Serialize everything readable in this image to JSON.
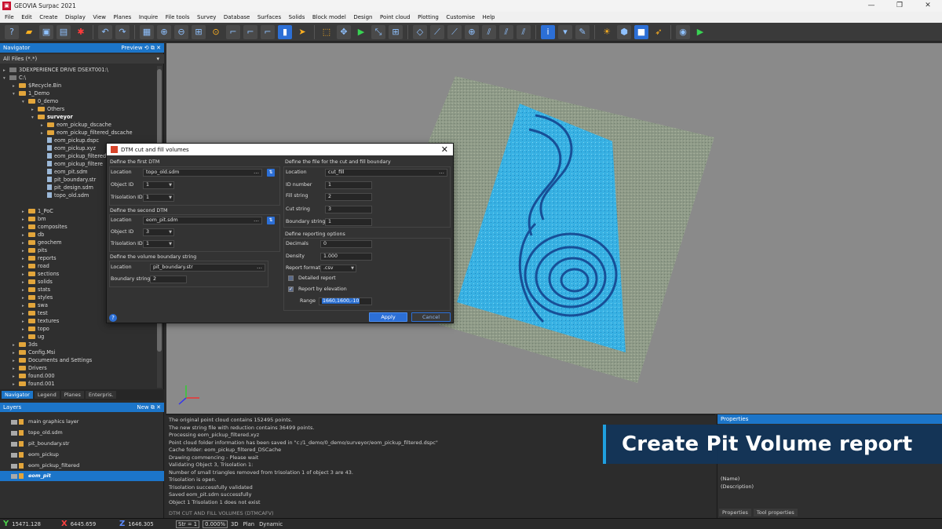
{
  "window": {
    "title": "GEOVIA Surpac 2021",
    "min": "—",
    "max": "❐",
    "close": "✕"
  },
  "menu": [
    "File",
    "Edit",
    "Create",
    "Display",
    "View",
    "Planes",
    "Inquire",
    "File tools",
    "Survey",
    "Database",
    "Surfaces",
    "Solids",
    "Block model",
    "Design",
    "Point cloud",
    "Plotting",
    "Customise",
    "Help"
  ],
  "navigator": {
    "title": "Navigator",
    "preview": "Preview",
    "filter": "All Files (*.*)",
    "tree": [
      {
        "indent": 0,
        "type": "drive",
        "label": "3DEXPERIENCE DRIVE DSEXT001:\\",
        "exp": "▸"
      },
      {
        "indent": 0,
        "type": "drive",
        "label": "C:\\",
        "exp": "▾"
      },
      {
        "indent": 1,
        "type": "folder",
        "label": "$Recycle.Bin",
        "exp": "▸"
      },
      {
        "indent": 1,
        "type": "folder",
        "label": "1_Demo",
        "exp": "▾"
      },
      {
        "indent": 2,
        "type": "folder",
        "label": "0_demo",
        "exp": "▾"
      },
      {
        "indent": 3,
        "type": "folder",
        "label": "Others",
        "exp": "▸"
      },
      {
        "indent": 3,
        "type": "folder",
        "label": "surveyor",
        "exp": "▾",
        "bold": true
      },
      {
        "indent": 4,
        "type": "folder",
        "label": "eom_pickup_dscache",
        "exp": "▸"
      },
      {
        "indent": 4,
        "type": "folder",
        "label": "eom_pickup_filtered_dscache",
        "exp": "▸"
      },
      {
        "indent": 4,
        "type": "file",
        "label": "eom_pickup.dspc",
        "exp": ""
      },
      {
        "indent": 4,
        "type": "file",
        "label": "eom_pickup.xyz",
        "exp": ""
      },
      {
        "indent": 4,
        "type": "file",
        "label": "eom_pickup_filtered",
        "exp": ""
      },
      {
        "indent": 4,
        "type": "file",
        "label": "eom_pickup_filtere",
        "exp": ""
      },
      {
        "indent": 4,
        "type": "file",
        "label": "eom_pit.sdm",
        "exp": ""
      },
      {
        "indent": 4,
        "type": "file",
        "label": "pit_boundary.str",
        "exp": ""
      },
      {
        "indent": 4,
        "type": "file",
        "label": "pit_design.sdm",
        "exp": ""
      },
      {
        "indent": 4,
        "type": "file",
        "label": "topo_old.sdm",
        "exp": ""
      },
      {
        "indent": 2,
        "type": "blank",
        "label": "",
        "exp": ""
      },
      {
        "indent": 2,
        "type": "folder",
        "label": "1_PoC",
        "exp": "▸"
      },
      {
        "indent": 2,
        "type": "folder",
        "label": "bm",
        "exp": "▸"
      },
      {
        "indent": 2,
        "type": "folder",
        "label": "composites",
        "exp": "▸"
      },
      {
        "indent": 2,
        "type": "folder",
        "label": "db",
        "exp": "▸"
      },
      {
        "indent": 2,
        "type": "folder",
        "label": "geochem",
        "exp": "▸"
      },
      {
        "indent": 2,
        "type": "folder",
        "label": "pits",
        "exp": "▸"
      },
      {
        "indent": 2,
        "type": "folder",
        "label": "reports",
        "exp": "▸"
      },
      {
        "indent": 2,
        "type": "folder",
        "label": "road",
        "exp": "▸"
      },
      {
        "indent": 2,
        "type": "folder",
        "label": "sections",
        "exp": "▸"
      },
      {
        "indent": 2,
        "type": "folder",
        "label": "solids",
        "exp": "▸"
      },
      {
        "indent": 2,
        "type": "folder",
        "label": "stats",
        "exp": "▸"
      },
      {
        "indent": 2,
        "type": "folder",
        "label": "styles",
        "exp": "▸"
      },
      {
        "indent": 2,
        "type": "folder",
        "label": "swa",
        "exp": "▸"
      },
      {
        "indent": 2,
        "type": "folder",
        "label": "test",
        "exp": "▸"
      },
      {
        "indent": 2,
        "type": "folder",
        "label": "textures",
        "exp": "▸"
      },
      {
        "indent": 2,
        "type": "folder",
        "label": "topo",
        "exp": "▸"
      },
      {
        "indent": 2,
        "type": "folder",
        "label": "ug",
        "exp": "▸"
      },
      {
        "indent": 1,
        "type": "folder",
        "label": "3ds",
        "exp": "▸"
      },
      {
        "indent": 1,
        "type": "folder",
        "label": "Config.Msi",
        "exp": "▸"
      },
      {
        "indent": 1,
        "type": "folder",
        "label": "Documents and Settings",
        "exp": "▸"
      },
      {
        "indent": 1,
        "type": "folder",
        "label": "Drivers",
        "exp": "▸"
      },
      {
        "indent": 1,
        "type": "folder",
        "label": "found.000",
        "exp": "▸"
      },
      {
        "indent": 1,
        "type": "folder",
        "label": "found.001",
        "exp": "▸"
      },
      {
        "indent": 1,
        "type": "folder",
        "label": "found.002",
        "exp": "▸"
      }
    ],
    "tabs": [
      "Navigator",
      "Legend",
      "Planes",
      "Enterpris."
    ]
  },
  "layers": {
    "title": "Layers",
    "new": "New",
    "items": [
      "main graphics layer",
      "topo_old.sdm",
      "pit_boundary.str",
      "eom_pickup",
      "eom_pickup_filtered",
      "eom_pit"
    ]
  },
  "dialog": {
    "title": "DTM cut and fill volumes",
    "first": {
      "heading": "Define the first DTM",
      "location_label": "Location",
      "location": "topo_old.sdm",
      "object_label": "Object ID",
      "object": "1",
      "tris_label": "Trisolation ID",
      "tris": "1"
    },
    "second": {
      "heading": "Define the second DTM",
      "location_label": "Location",
      "location": "eom_pit.sdm",
      "object_label": "Object ID",
      "object": "3",
      "tris_label": "Trisolation ID",
      "tris": "1"
    },
    "boundary": {
      "heading": "Define the volume boundary string",
      "location_label": "Location",
      "location": "pit_boundary.str",
      "string_label": "Boundary string",
      "string": "2"
    },
    "output": {
      "heading": "Define the file for the cut and fill boundary",
      "location_label": "Location",
      "location": "cut_fill",
      "id_label": "ID number",
      "id": "1",
      "fill_label": "Fill string",
      "fill": "2",
      "cut_label": "Cut string",
      "cut": "3",
      "bnd_label": "Boundary string",
      "bnd": "1"
    },
    "report": {
      "heading": "Define reporting options",
      "decimals_label": "Decimals",
      "decimals": "0",
      "density_label": "Density",
      "density": "1.000",
      "format_label": "Report format",
      "format": ".csv",
      "detailed": "Detailed report",
      "by_elev": "Report by elevation",
      "range_label": "Range",
      "range": "1660,1600,-10"
    },
    "apply": "Apply",
    "cancel": "Cancel",
    "help": "?"
  },
  "log": {
    "lines": [
      "The original point cloud contains 152495 points.",
      "The new string file with reduction contains 36499 points.",
      "Processing eom_pickup_filtered.xyz",
      "Point cloud folder information has been saved in \"c:/1_demo/0_demo/surveyor/eom_pickup_filtered.dspc\"",
      "Cache folder: eom_pickup_filtered_DSCache",
      "Drawing commencing - Please wait",
      "Validating Object 3, Trisolation 1:",
      "Number of small triangles removed from trisolation 1 of object 3 are 43.",
      "  Trisolation is open.",
      "  Trisolation successfully validated",
      "Saved eom_pit.sdm successfully",
      "Object 1 Trisolation 1 does not exist"
    ],
    "command": "DTM CUT AND FILL VOLUMES (DTMCAFV)"
  },
  "properties": {
    "title": "Properties",
    "name": "(Name)",
    "description": "(Description)",
    "tabs": [
      "Properties",
      "Tool properties"
    ]
  },
  "banner": "Create Pit Volume report",
  "status": {
    "y": "15471.128",
    "x": "6445.659",
    "z": "1646.305",
    "str_label": "Str = 1",
    "zoom": "0.000%",
    "mode3d": "3D",
    "plan": "Plan",
    "dynamic": "Dynamic"
  },
  "colors": {
    "accent": "#1c75c9",
    "surface": "#3fb3e0"
  }
}
